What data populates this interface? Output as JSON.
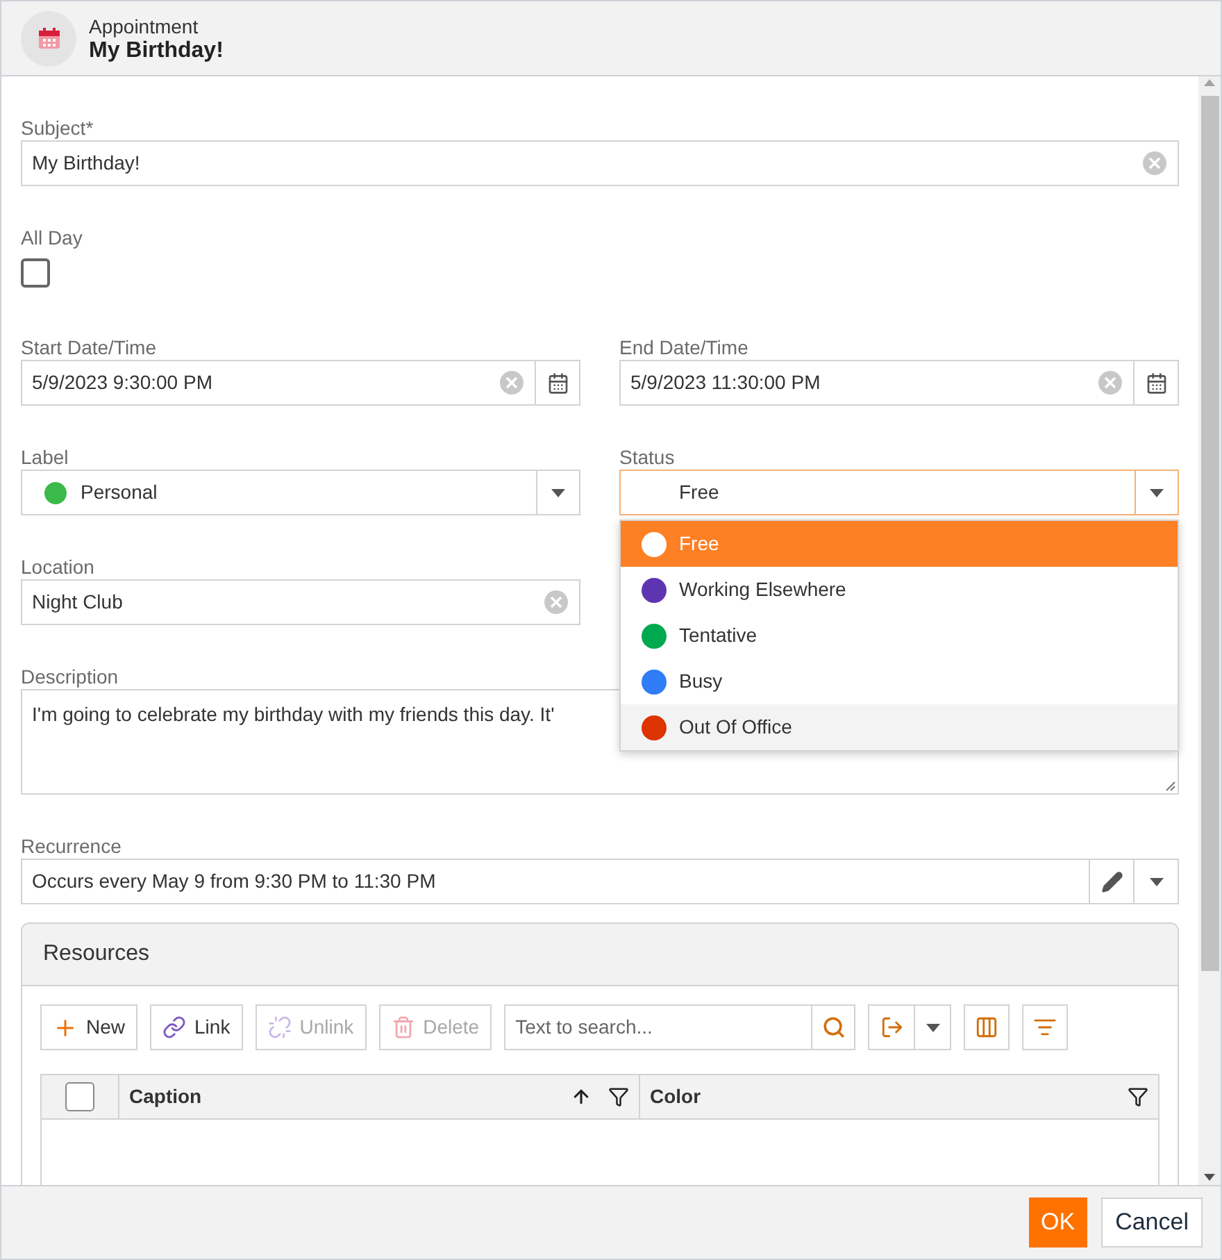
{
  "header": {
    "kind_label": "Appointment",
    "title": "My Birthday!"
  },
  "subject": {
    "label": "Subject*",
    "value": "My Birthday!"
  },
  "all_day": {
    "label": "All Day",
    "checked": false
  },
  "start": {
    "label": "Start Date/Time",
    "value": "5/9/2023 9:30:00 PM"
  },
  "end": {
    "label": "End Date/Time",
    "value": "5/9/2023 11:30:00 PM"
  },
  "label_field": {
    "label": "Label",
    "value": "Personal",
    "color": "#3cb94b"
  },
  "status": {
    "label": "Status",
    "value": "Free",
    "expanded": true,
    "options": [
      {
        "label": "Free",
        "color": "#ffffff",
        "selected": true,
        "hovered": false
      },
      {
        "label": "Working Elsewhere",
        "color": "#5e35b1",
        "selected": false,
        "hovered": false
      },
      {
        "label": "Tentative",
        "color": "#00a94f",
        "selected": false,
        "hovered": false
      },
      {
        "label": "Busy",
        "color": "#2f7cf6",
        "selected": false,
        "hovered": false
      },
      {
        "label": "Out Of Office",
        "color": "#dd3300",
        "selected": false,
        "hovered": true
      }
    ]
  },
  "location": {
    "label": "Location",
    "value": "Night Club"
  },
  "description": {
    "label": "Description",
    "value": "I'm going to celebrate my birthday with my friends this day. It'"
  },
  "recurrence": {
    "label": "Recurrence",
    "value": "Occurs every May 9 from 9:30 PM to 11:30 PM"
  },
  "resources": {
    "title": "Resources",
    "toolbar": [
      {
        "kind": "new",
        "label": "New",
        "disabled": false
      },
      {
        "kind": "link",
        "label": "Link",
        "disabled": false
      },
      {
        "kind": "unlink",
        "label": "Unlink",
        "disabled": true
      },
      {
        "kind": "delete",
        "label": "Delete",
        "disabled": true
      }
    ],
    "search": {
      "placeholder": "Text to search..."
    },
    "columns": [
      {
        "label": "Caption",
        "sorted": true
      },
      {
        "label": "Color",
        "sorted": false
      }
    ],
    "select_all": false
  },
  "buttons": [
    {
      "kind": "primary",
      "label": "OK"
    },
    {
      "kind": "secondary",
      "label": "Cancel"
    }
  ]
}
